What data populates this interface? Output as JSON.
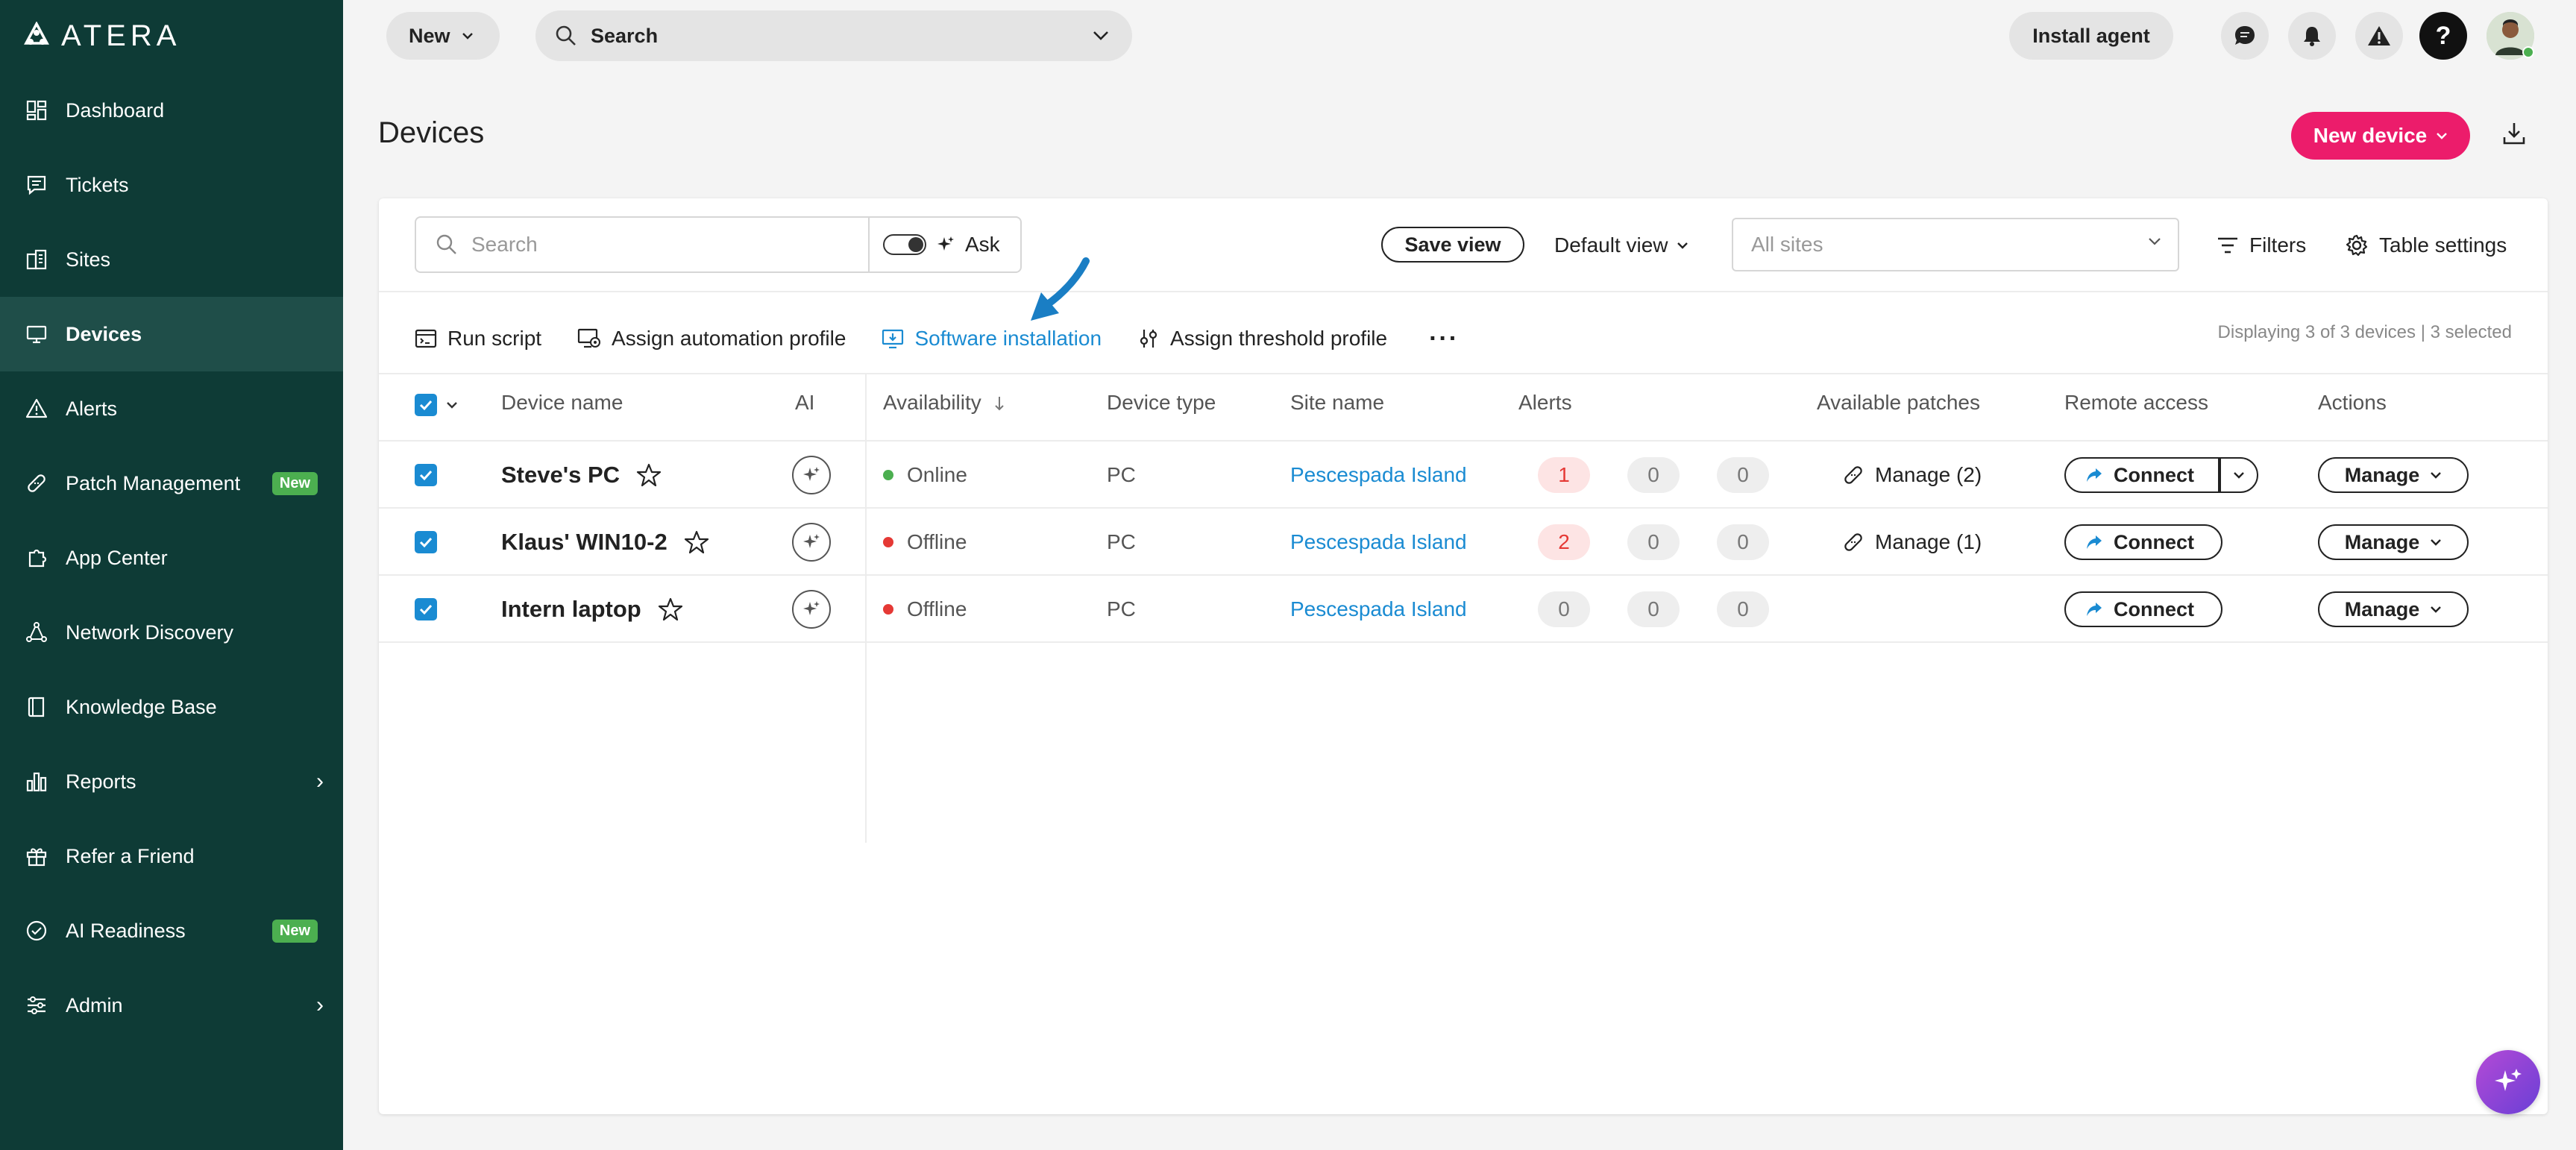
{
  "brand": {
    "logo_text": "ATERA"
  },
  "sidebar": {
    "items": [
      {
        "label": "Dashboard",
        "icon": "dashboard-icon"
      },
      {
        "label": "Tickets",
        "icon": "tickets-icon"
      },
      {
        "label": "Sites",
        "icon": "sites-icon"
      },
      {
        "label": "Devices",
        "icon": "devices-icon",
        "active": true
      },
      {
        "label": "Alerts",
        "icon": "alerts-icon"
      },
      {
        "label": "Patch Management",
        "icon": "patch-icon",
        "badge": "New"
      },
      {
        "label": "App Center",
        "icon": "app-center-icon"
      },
      {
        "label": "Network Discovery",
        "icon": "network-icon"
      },
      {
        "label": "Knowledge Base",
        "icon": "knowledge-base-icon"
      },
      {
        "label": "Reports",
        "icon": "reports-icon",
        "submenu": true
      },
      {
        "label": "Refer a Friend",
        "icon": "gift-icon"
      },
      {
        "label": "AI Readiness",
        "icon": "ai-readiness-icon",
        "badge": "New"
      },
      {
        "label": "Admin",
        "icon": "admin-icon",
        "submenu": true
      }
    ]
  },
  "topbar": {
    "new_label": "New",
    "search_label": "Search",
    "install_agent_label": "Install agent"
  },
  "header": {
    "title": "Devices",
    "new_device_label": "New device"
  },
  "toolbar": {
    "search_placeholder": "Search",
    "ask_label": "Ask",
    "save_view_label": "Save view",
    "default_view_label": "Default view",
    "sites_placeholder": "All sites",
    "filters_label": "Filters",
    "table_settings_label": "Table settings"
  },
  "actions": {
    "run_script": "Run script",
    "assign_automation": "Assign automation profile",
    "software_installation": "Software installation",
    "assign_threshold": "Assign threshold profile",
    "displaying": "Displaying 3 of 3 devices | 3 selected"
  },
  "table": {
    "columns": {
      "device_name": "Device name",
      "ai": "AI",
      "availability": "Availability",
      "device_type": "Device type",
      "site_name": "Site name",
      "alerts": "Alerts",
      "available_patches": "Available patches",
      "remote_access": "Remote access",
      "actions": "Actions"
    },
    "rows": [
      {
        "name": "Steve's PC",
        "status": "Online",
        "type": "PC",
        "site": "Pescespada Island",
        "alerts": [
          "1",
          "0",
          "0"
        ],
        "patches": "Manage (2)",
        "connect": "Connect",
        "manage": "Manage"
      },
      {
        "name": "Klaus' WIN10-2",
        "status": "Offline",
        "type": "PC",
        "site": "Pescespada Island",
        "alerts": [
          "2",
          "0",
          "0"
        ],
        "patches": "Manage (1)",
        "connect": "Connect",
        "manage": "Manage"
      },
      {
        "name": "Intern laptop",
        "status": "Offline",
        "type": "PC",
        "site": "Pescespada Island",
        "alerts": [
          "0",
          "0",
          "0"
        ],
        "patches": "",
        "connect": "Connect",
        "manage": "Manage"
      }
    ]
  },
  "colors": {
    "sidebar": "#0e3b36",
    "accent": "#ec1c6b",
    "link": "#1a8bd2",
    "badge": "#4caf50"
  }
}
